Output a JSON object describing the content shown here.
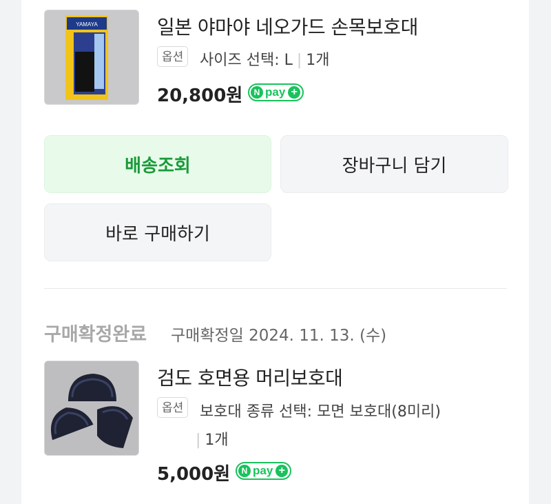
{
  "order1": {
    "product_title": "일본 야마야 네오가드 손목보호대",
    "option_tag": "옵션",
    "option_text": "사이즈 선택: L",
    "quantity": "1개",
    "price": "20,800원",
    "npay_n": "N",
    "npay_text": "pay",
    "npay_plus": "+",
    "thumb_brand": "YAMAYA",
    "buttons": {
      "track_delivery": "배송조회",
      "add_to_cart": "장바구니 담기",
      "buy_now": "바로 구매하기"
    }
  },
  "order2": {
    "status": "구매확정완료",
    "confirm_date": "구매확정일 2024. 11. 13. (수)",
    "product_title": "검도 호면용 머리보호대",
    "option_tag": "옵션",
    "option_text": "보호대 종류 선택: 모면 보호대(8미리)",
    "quantity": "1개",
    "price": "5,000원",
    "npay_n": "N",
    "npay_text": "pay",
    "npay_plus": "+"
  },
  "colors": {
    "background": "#f2f3f5",
    "card": "#ffffff",
    "npay_green": "#19c25c",
    "primary_button_bg": "#e8fbea",
    "primary_button_text": "#1a9a3a",
    "button_bg": "#f4f5f7",
    "status_grey": "#a8a8a8"
  }
}
